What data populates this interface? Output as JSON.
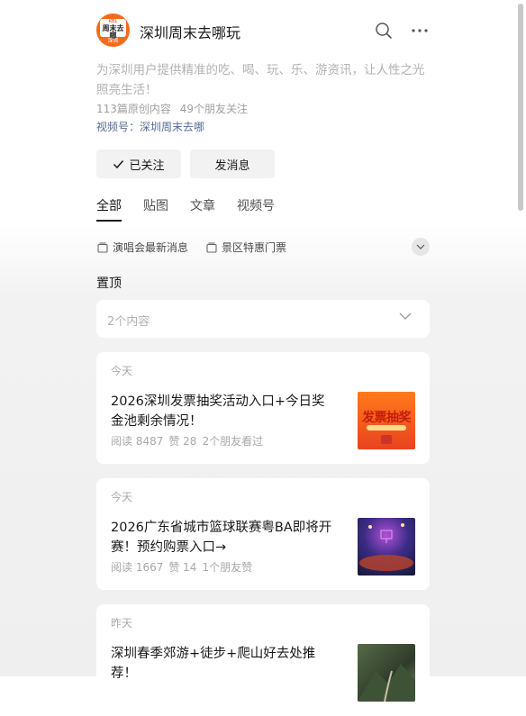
{
  "account": {
    "name": "深圳周末去哪玩",
    "logo_text": {
      "top": "KBL",
      "middle": "周末去哪",
      "bottom": "深圳"
    },
    "description": "为深圳用户提供精准的吃、喝、玩、乐、游资讯，让人性之光照亮生活！",
    "original_count": "113篇原创内容",
    "friends_follow": "49个朋友关注",
    "channel": "视频号：深圳周末去哪"
  },
  "header": {
    "search_icon": "search-icon",
    "more_icon": "more-icon"
  },
  "buttons": {
    "followed_label": "已关注",
    "message_label": "发消息"
  },
  "tabs": [
    {
      "label": "全部",
      "active": true
    },
    {
      "label": "贴图",
      "active": false
    },
    {
      "label": "文章",
      "active": false
    },
    {
      "label": "视频号",
      "active": false
    }
  ],
  "topics": [
    {
      "label": "演唱会最新消息"
    },
    {
      "label": "景区特惠门票"
    }
  ],
  "pinned": {
    "title": "置顶",
    "summary": "2个内容"
  },
  "articles": [
    {
      "date": "今天",
      "title": "2026深圳发票抽奖活动入口+今日奖金池剩余情况！",
      "reads": "阅读 8487",
      "likes": "赞 28",
      "social": "2个朋友看过",
      "thumb_text": "发票抽奖"
    },
    {
      "date": "今天",
      "title": "2026广东省城市篮球联赛粤BA即将开赛！预约购票入口→",
      "reads": "阅读 1667",
      "likes": "赞 14",
      "social": "1个朋友赞"
    },
    {
      "date": "昨天",
      "title": "深圳春季郊游+徒步+爬山好去处推荐！"
    }
  ],
  "colors": {
    "link": "#576b95",
    "logo": "#f36b1c",
    "muted": "#a8a8a8"
  }
}
